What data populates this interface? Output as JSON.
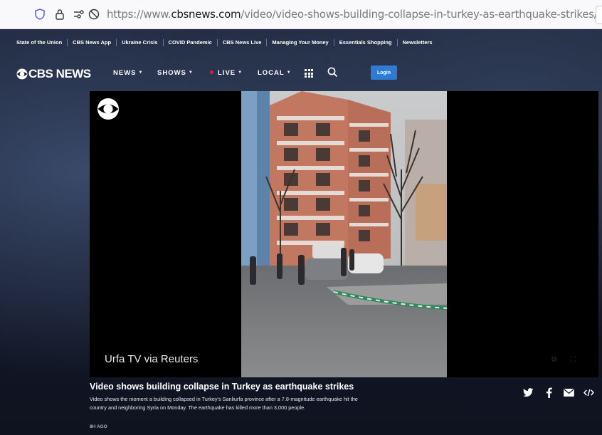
{
  "browser": {
    "url_prefix": "https://www.",
    "url_domain": "cbsnews.com",
    "url_path": "/video/video-shows-building-collapse-in-turkey-as-earthquake-strikes/#x"
  },
  "topnav": {
    "links": [
      "State of the Union",
      "CBS News App",
      "Ukraine Crisis",
      "COVID Pandemic",
      "CBS News Live",
      "Managing Your Money",
      "Essentials Shopping",
      "Newsletters"
    ]
  },
  "mainnav": {
    "logo_text": "CBS NEWS",
    "news": "NEWS",
    "shows": "SHOWS",
    "live": "LIVE",
    "local": "LOCAL",
    "login": "Login"
  },
  "video": {
    "credit": "Urfa TV via Reuters"
  },
  "article": {
    "title": "Video shows building collapse in Turkey as earthquake strikes",
    "description": "Video shows the moment a building collapsed in Turkey's Sanliurfa province after a 7.8-magnitude earthquake hit the country and neighboring Syria on Monday. The earthquake has killed more than 3,000 people.",
    "age": "8H AGO"
  },
  "colors": {
    "accent_blue": "#2f7bd3",
    "live_red": "#e11d2b"
  }
}
